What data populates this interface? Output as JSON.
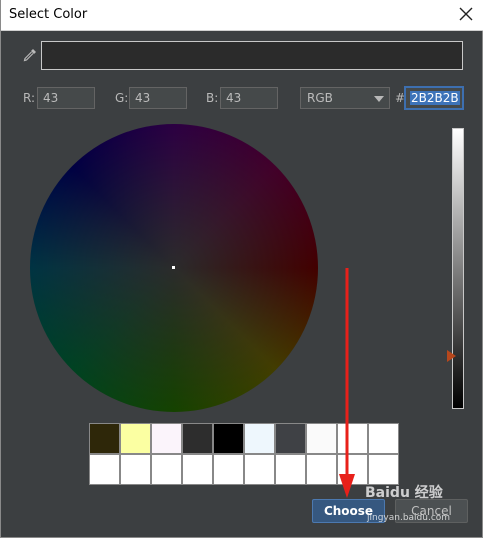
{
  "window": {
    "title": "Select Color"
  },
  "color": {
    "r_label": "R:",
    "r": "43",
    "g_label": "G:",
    "g": "43",
    "b_label": "B:",
    "b": "43",
    "mode": "RGB",
    "hash": "#",
    "hex": "2B2B2B",
    "preview_hex": "#2b2b2b"
  },
  "brightness_level": 0.19,
  "swatches": [
    "#2e2709",
    "#fbffa2",
    "#fbf4fb",
    "#2d2d2d",
    "#000000",
    "#eef7fd",
    "#3f4145",
    "#fafafa",
    "#ffffff",
    "#ffffff",
    "#ffffff",
    "#ffffff",
    "#ffffff",
    "#ffffff",
    "#ffffff",
    "#ffffff",
    "#ffffff",
    "#ffffff",
    "#ffffff",
    "#ffffff"
  ],
  "buttons": {
    "choose": "Choose",
    "cancel": "Cancel"
  },
  "icons": {
    "eyedropper": "eyedropper-icon",
    "close": "close-icon"
  },
  "accent": "#3d73b9",
  "annotation_color": "#e8201a",
  "watermark": {
    "brand": "Baidu 经验",
    "url": "jingyan.baidu.com"
  }
}
